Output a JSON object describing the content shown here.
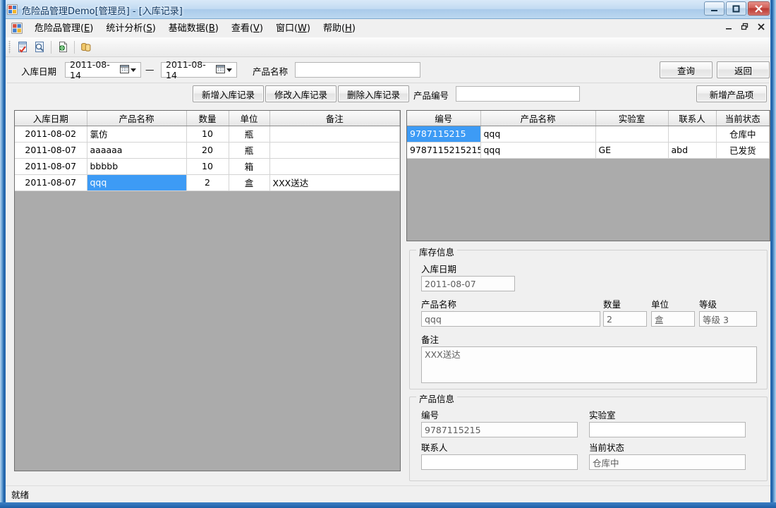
{
  "window": {
    "title": "危险品管理Demo[管理员] - [入库记录]",
    "app_icon": "app-window-icon",
    "controls": {
      "minimize": "–",
      "maximize": "□",
      "close": "✕"
    }
  },
  "menubar": {
    "app_icon": "app-window-icon",
    "items": [
      {
        "label": "危险品管理(E)",
        "text": "危险品管理(",
        "accel": "E",
        "tail": ")"
      },
      {
        "label": "统计分析(S)",
        "text": "统计分析(",
        "accel": "S",
        "tail": ")"
      },
      {
        "label": "基础数据(B)",
        "text": "基础数据(",
        "accel": "B",
        "tail": ")"
      },
      {
        "label": "查看(V)",
        "text": "查看(",
        "accel": "V",
        "tail": ")"
      },
      {
        "label": "窗口(W)",
        "text": "窗口(",
        "accel": "W",
        "tail": ")"
      },
      {
        "label": "帮助(H)",
        "text": "帮助(",
        "accel": "H",
        "tail": ")"
      }
    ],
    "mdi_controls": {
      "minimize": "_",
      "restore": "❐",
      "close": "✕"
    }
  },
  "toolbar": {
    "buttons": [
      {
        "name": "checklist-icon"
      },
      {
        "name": "search-document-icon"
      },
      {
        "name": "new-document-icon"
      },
      {
        "name": "database-icon"
      }
    ]
  },
  "filterbar": {
    "date_label": "入库日期",
    "date_from": "2011-08-14",
    "date_separator": "—",
    "date_to": "2011-08-14",
    "product_name_label": "产品名称",
    "product_name_value": "",
    "query_button": "查询",
    "back_button": "返回"
  },
  "actionbar": {
    "add_record_button": "新增入库记录",
    "edit_record_button": "修改入库记录",
    "delete_record_button": "删除入库记录",
    "product_no_label": "产品编号",
    "product_no_value": "",
    "add_product_button": "新增产品项"
  },
  "left_grid": {
    "columns": [
      "入库日期",
      "产品名称",
      "数量",
      "单位",
      "备注"
    ],
    "rows": [
      {
        "date": "2011-08-02",
        "product": "氯仿",
        "qty": "10",
        "unit": "瓶",
        "remark": "",
        "selected_cell": null
      },
      {
        "date": "2011-08-07",
        "product": "aaaaaa",
        "qty": "20",
        "unit": "瓶",
        "remark": "",
        "selected_cell": null
      },
      {
        "date": "2011-08-07",
        "product": "bbbbb",
        "qty": "10",
        "unit": "箱",
        "remark": "",
        "selected_cell": null
      },
      {
        "date": "2011-08-07",
        "product": "qqq",
        "qty": "2",
        "unit": "盒",
        "remark": "XXX送达",
        "selected_cell": "product"
      }
    ]
  },
  "right_grid": {
    "columns": [
      "编号",
      "产品名称",
      "实验室",
      "联系人",
      "当前状态"
    ],
    "rows": [
      {
        "no": "9787115215",
        "product": "qqq",
        "lab": "",
        "contact": "",
        "status": "仓库中",
        "selected_cell": "no"
      },
      {
        "no": "9787115215215",
        "product": "qqq",
        "lab": "GE",
        "contact": "abd",
        "status": "已发货",
        "selected_cell": null
      }
    ]
  },
  "stock_info": {
    "group_title": "库存信息",
    "date_label": "入库日期",
    "date_value": "2011-08-07",
    "product_label": "产品名称",
    "product_value": "qqq",
    "qty_label": "数量",
    "qty_value": "2",
    "unit_label": "单位",
    "unit_value": "盒",
    "grade_label": "等级",
    "grade_value": "等级 3",
    "remark_label": "备注",
    "remark_value": "XXX送达"
  },
  "product_info": {
    "group_title": "产品信息",
    "no_label": "编号",
    "no_value": "9787115215",
    "lab_label": "实验室",
    "lab_value": "",
    "contact_label": "联系人",
    "contact_value": "",
    "status_label": "当前状态",
    "status_value": "仓库中"
  },
  "statusbar": {
    "text": "就绪"
  },
  "colors": {
    "selection_blue": "#3d9bf5",
    "grid_empty_gray": "#ababab",
    "form_background": "#f0f0f0",
    "title_close_red": "#bb3a33"
  }
}
